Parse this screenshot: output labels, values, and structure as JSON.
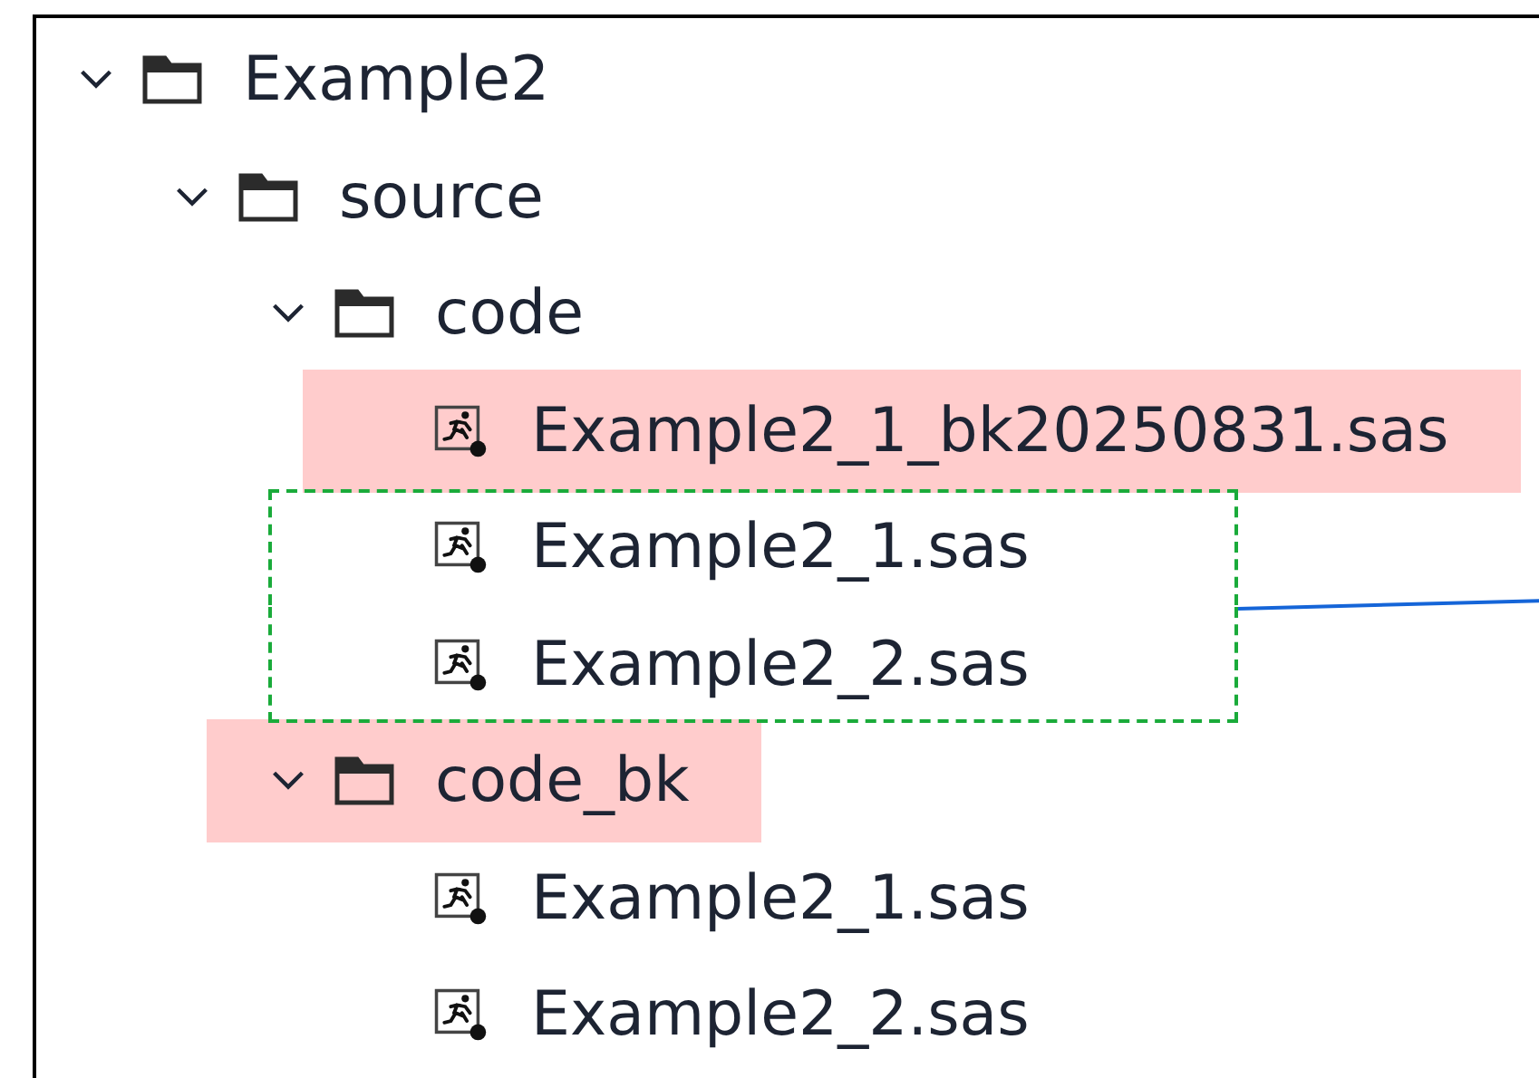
{
  "tree": [
    {
      "kind": "folder",
      "name": "Example2",
      "expanded": true,
      "highlighted": false,
      "boxed": false,
      "children": [
        {
          "kind": "folder",
          "name": "source",
          "expanded": true,
          "highlighted": false,
          "boxed": false,
          "children": [
            {
              "kind": "folder",
              "name": "code",
              "expanded": true,
              "highlighted": false,
              "boxed": false,
              "children": [
                {
                  "kind": "file",
                  "name": "Example2_1_bk20250831.sas",
                  "highlighted": true,
                  "boxed": false
                },
                {
                  "kind": "file",
                  "name": "Example2_1.sas",
                  "highlighted": false,
                  "boxed": true
                },
                {
                  "kind": "file",
                  "name": "Example2_2.sas",
                  "highlighted": false,
                  "boxed": true
                }
              ]
            },
            {
              "kind": "folder",
              "name": "code_bk",
              "expanded": true,
              "highlighted": true,
              "boxed": false,
              "children": [
                {
                  "kind": "file",
                  "name": "Example2_1.sas",
                  "highlighted": false,
                  "boxed": false
                },
                {
                  "kind": "file",
                  "name": "Example2_2.sas",
                  "highlighted": false,
                  "boxed": false
                }
              ]
            }
          ]
        }
      ]
    }
  ]
}
